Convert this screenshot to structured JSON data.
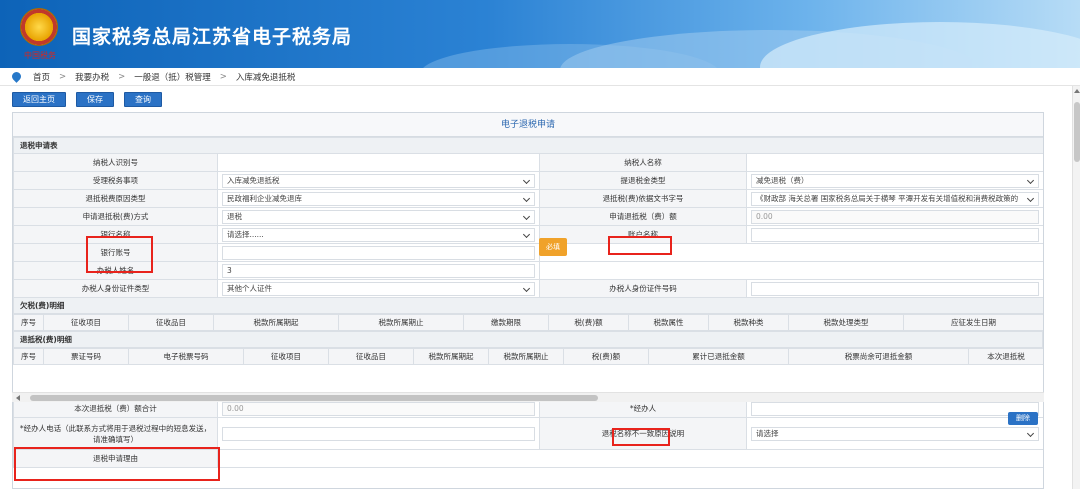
{
  "header": {
    "site_title": "国家税务总局江苏省电子税务局",
    "emblem_caption": "中国税务"
  },
  "breadcrumb": {
    "items": [
      "首页",
      "我要办税",
      "一般退（抵）税管理",
      "入库减免退抵税"
    ],
    "separator": ">"
  },
  "toolbar": {
    "back_label": "返回主页",
    "save_label": "保存",
    "query_label": "查询"
  },
  "panel": {
    "title": "电子退税申请"
  },
  "form": {
    "section_title": "退税申请表",
    "taxpayer_id_label": "纳税人识别号",
    "taxpayer_name_label": "纳税人名称",
    "taxpayer_name_value": "",
    "matter_label": "受理税务事项",
    "matter_value": "入库减免退抵税",
    "refund_type_label": "提退税金类型",
    "refund_type_value": "减免退税（费）",
    "reason_type_label": "退抵税费原因类型",
    "reason_type_value": "民政福利企业减免退库",
    "doc_no_label": "退抵税(费)依据文书字号",
    "doc_no_value": "《财政部 海关总署 国家税务总局关于横琴 平潭开发有关增值税和消费税政策的",
    "method_label": "申请退抵税(费)方式",
    "method_value": "退税",
    "amount_label": "申请退抵税（费）额",
    "amount_value": "0.00",
    "bank_name_label": "银行名称",
    "bank_name_placeholder": "请选择......",
    "bank_tag": "必填",
    "account_name_label": "账户名称",
    "bank_account_label": "银行账号",
    "handler_name_label": "办税人姓名",
    "handler_name_value": "3",
    "id_type_label": "办税人身份证件类型",
    "id_type_value": "其他个人证件",
    "id_no_label": "办税人身份证件号码"
  },
  "arrears": {
    "section_title": "欠税(费)明细",
    "columns": [
      "序号",
      "征收项目",
      "征收品目",
      "税款所属期起",
      "税款所属期止",
      "缴款期限",
      "税(费)额",
      "税款属性",
      "税款种类",
      "税款处理类型",
      "应征发生日期"
    ]
  },
  "refund_detail": {
    "section_title": "退抵税(费)明细",
    "columns": [
      "序号",
      "票证号码",
      "电子税票号码",
      "征收项目",
      "征收品目",
      "税款所属期起",
      "税款所属期止",
      "税(费)额",
      "累计已退抵金额",
      "税票尚余可退抵金额",
      "本次退抵税"
    ]
  },
  "delete_label": "删除",
  "bottom": {
    "total_label": "本次退抵税（费）额合计",
    "total_value": "0.00",
    "handler_label": "*经办人",
    "phone_label": "*经办人电话（此联系方式将用于退税过程中的短息发送，请准确填写）",
    "mismatch_label": "退税名称不一致原因说明",
    "mismatch_value": "请选择",
    "next_row_label": "退税申请理由"
  }
}
